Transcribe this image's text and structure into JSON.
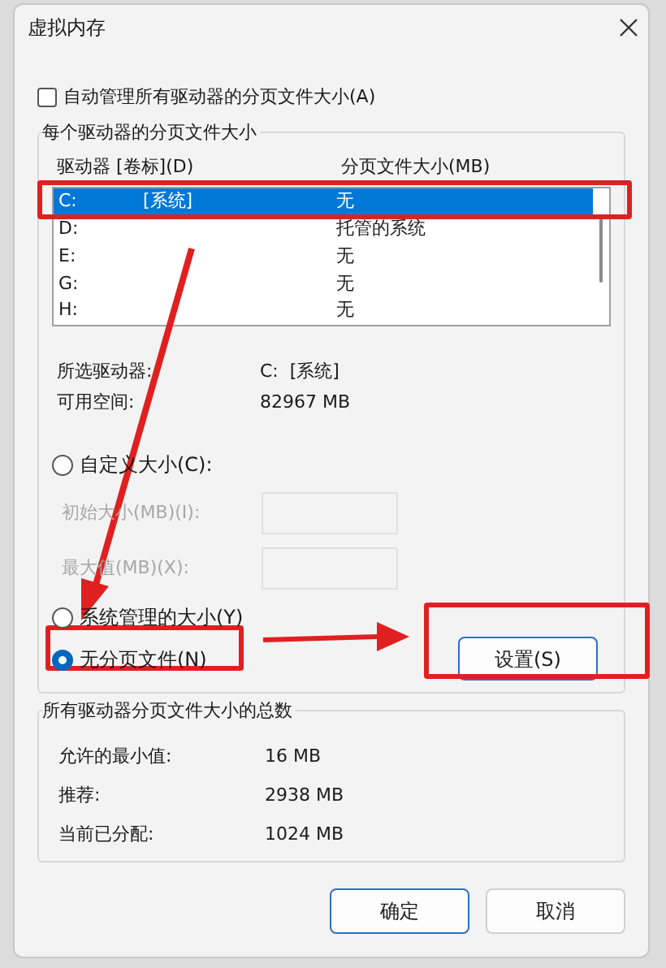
{
  "window": {
    "title": "虚拟内存"
  },
  "auto_manage": {
    "label": "自动管理所有驱动器的分页文件大小(A)",
    "checked": false
  },
  "per_drive": {
    "title": "每个驱动器的分页文件大小",
    "columns": [
      "驱动器 [卷标](D)",
      "分页文件大小(MB)"
    ],
    "rows": [
      {
        "drive": "C:",
        "volume": "[系统]",
        "size": "无",
        "selected": true
      },
      {
        "drive": "D:",
        "size": "托管的系统",
        "selected": false
      },
      {
        "drive": "E:",
        "size": "无",
        "selected": false
      },
      {
        "drive": "G:",
        "size": "无",
        "selected": false
      },
      {
        "drive": "H:",
        "size": "无",
        "selected": false
      }
    ],
    "info": [
      {
        "label": "所选驱动器:",
        "value": "C:  [系统]"
      },
      {
        "label": "可用空间:",
        "value": "82967 MB"
      }
    ],
    "options": [
      {
        "kind": "radio",
        "label": "自定义大小(C):",
        "selected": false
      },
      {
        "kind": "field",
        "label": "初始大小(MB)(I):",
        "disabled": true
      },
      {
        "kind": "field",
        "label": "最大值(MB)(X):",
        "disabled": true
      },
      {
        "kind": "radio",
        "label": "系统管理的大小(Y)",
        "selected": false
      },
      {
        "kind": "radio",
        "label": "无分页文件(N)",
        "selected": true
      }
    ],
    "set_button": "设置(S)"
  },
  "totals": {
    "title": "所有驱动器分页文件大小的总数",
    "rows": [
      {
        "label": "允许的最小值:",
        "value": "16 MB"
      },
      {
        "label": "推荐:",
        "value": "2938 MB"
      },
      {
        "label": "当前已分配:",
        "value": "1024 MB"
      }
    ]
  },
  "buttons": [
    {
      "label": "确定",
      "default": true
    },
    {
      "label": "取消",
      "default": false
    }
  ]
}
